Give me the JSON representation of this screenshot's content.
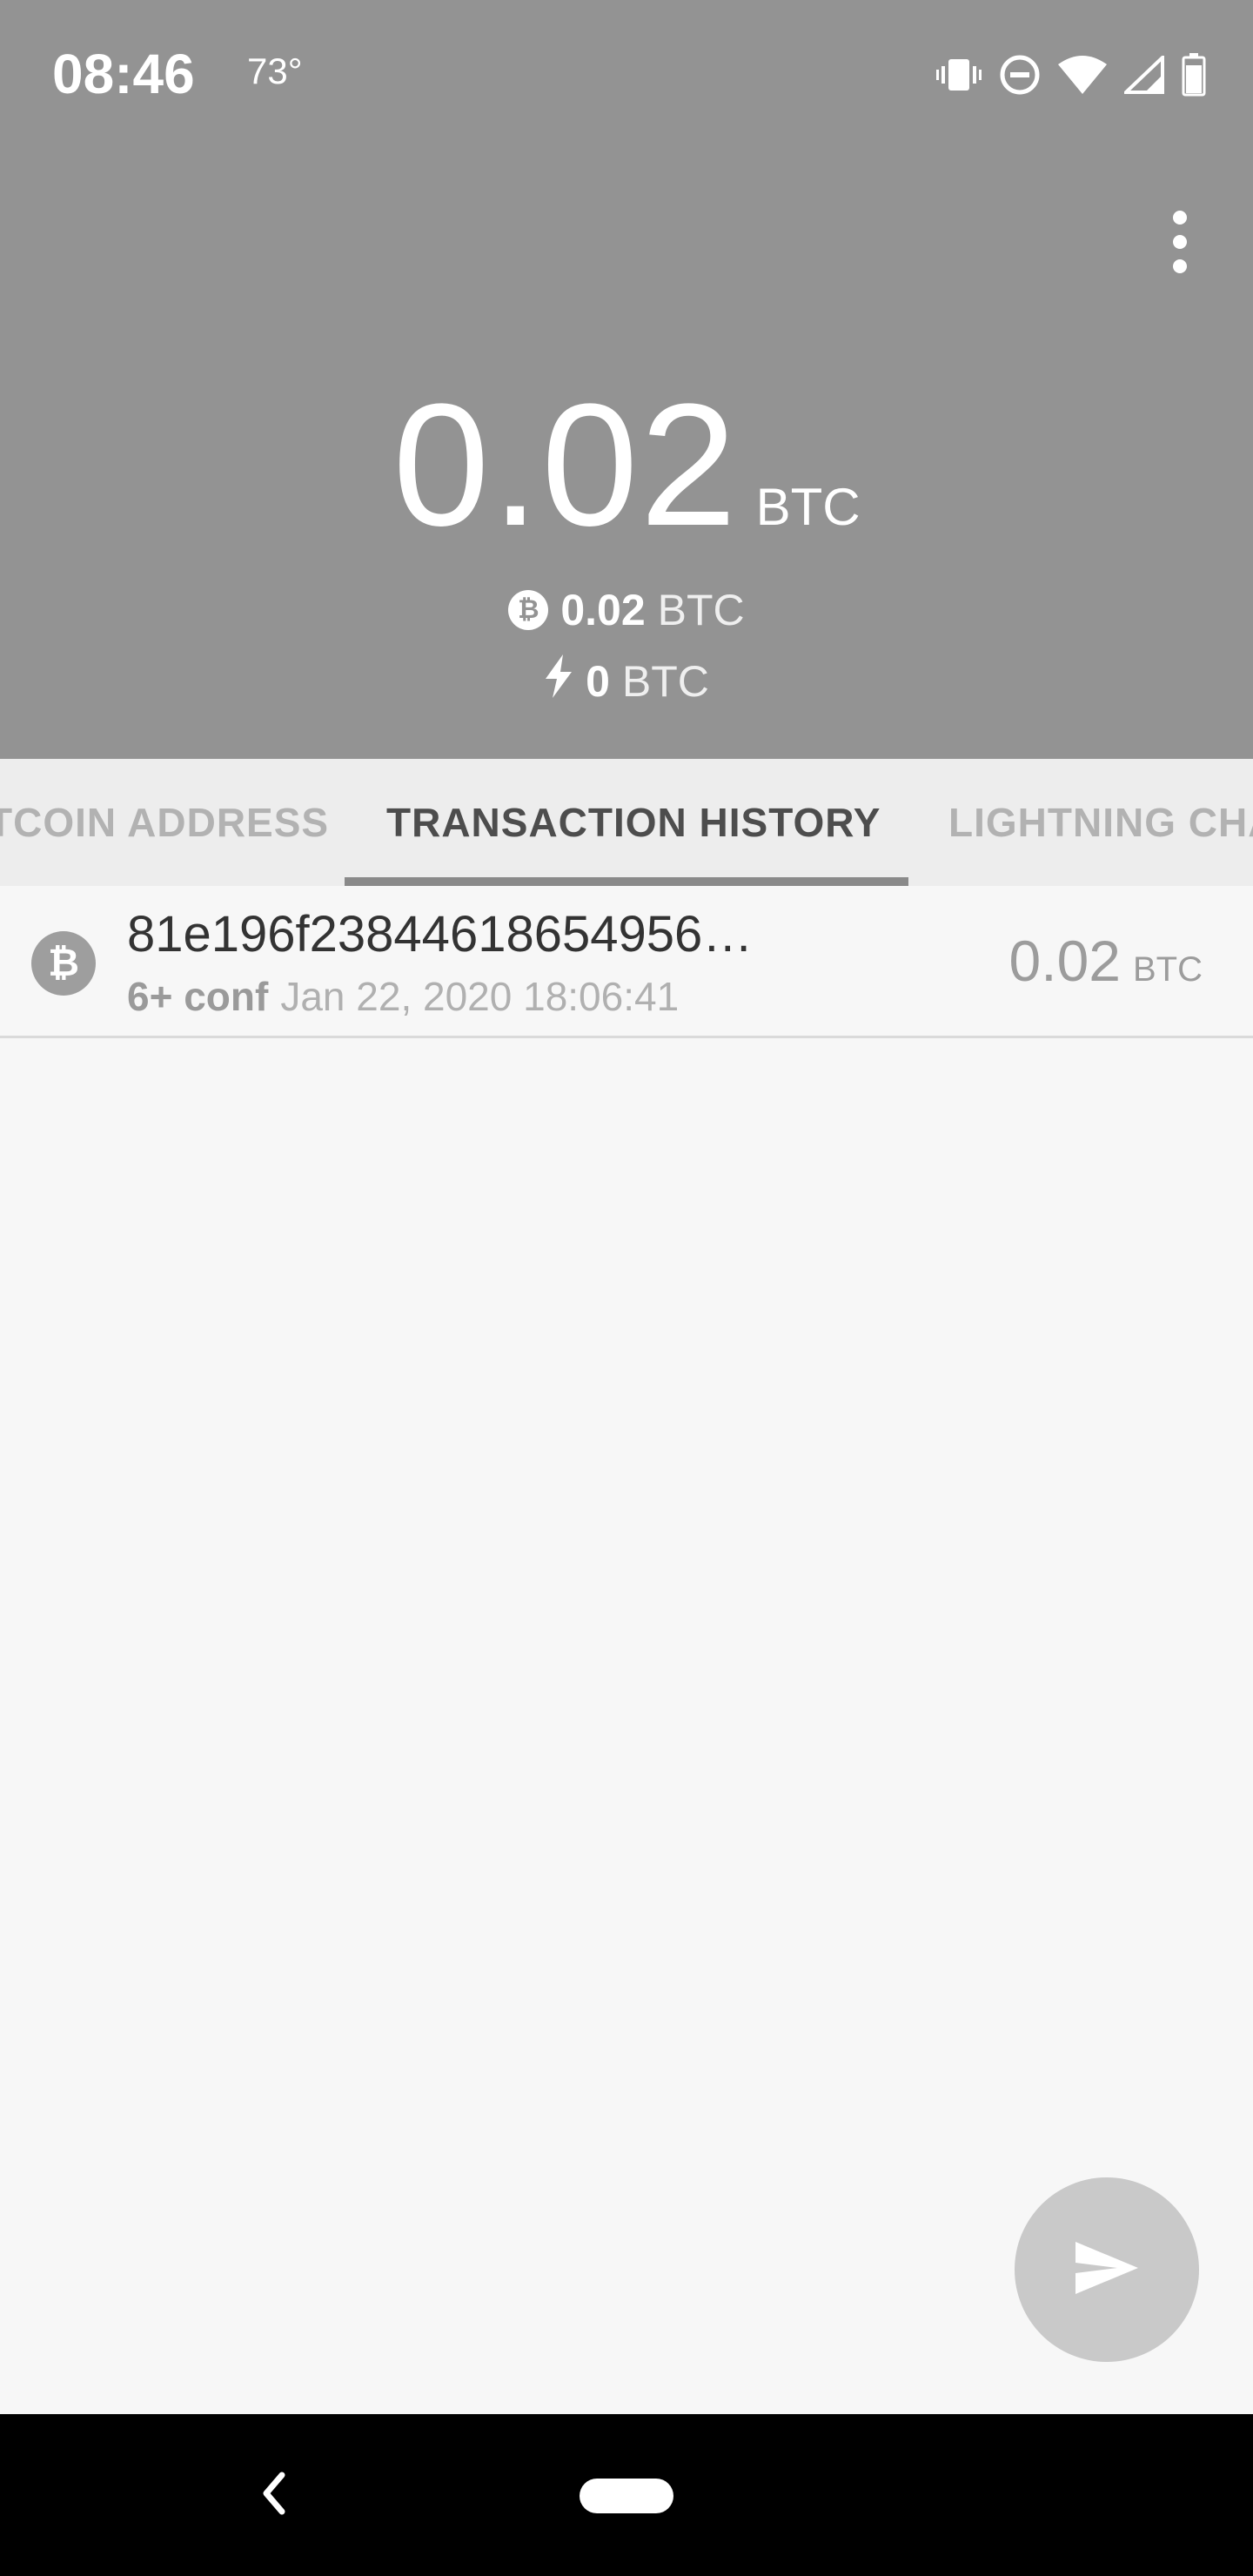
{
  "status_bar": {
    "time": "08:46",
    "temperature": "73°",
    "icons": [
      "vibrate-icon",
      "do-not-disturb-icon",
      "wifi-icon",
      "cell-signal-icon",
      "battery-icon"
    ]
  },
  "header": {
    "balance_value": "0.02",
    "balance_unit": "BTC",
    "onchain_value": "0.02",
    "onchain_unit": "BTC",
    "lightning_value": "0",
    "lightning_unit": "BTC",
    "menu_icon": "more-vert-icon",
    "background_color": "#939393"
  },
  "tabs": [
    {
      "label": "BITCOIN ADDRESS",
      "visible_label": "TCOIN ADDRESS",
      "active": false
    },
    {
      "label": "TRANSACTION HISTORY",
      "active": true
    },
    {
      "label": "LIGHTNING CHANNELS",
      "visible_label": "LIGHTNING CHA",
      "active": false
    }
  ],
  "transactions": [
    {
      "icon": "bitcoin-icon",
      "hash": "81e196f23844618654956…",
      "confirmations": "6+ conf",
      "date": "Jan 22, 2020 18:06:41",
      "amount": "0.02",
      "unit": "BTC"
    }
  ],
  "fab": {
    "icon": "send-icon"
  },
  "nav_bar": {
    "back_icon": "back-icon",
    "home_icon": "home-pill-icon"
  }
}
